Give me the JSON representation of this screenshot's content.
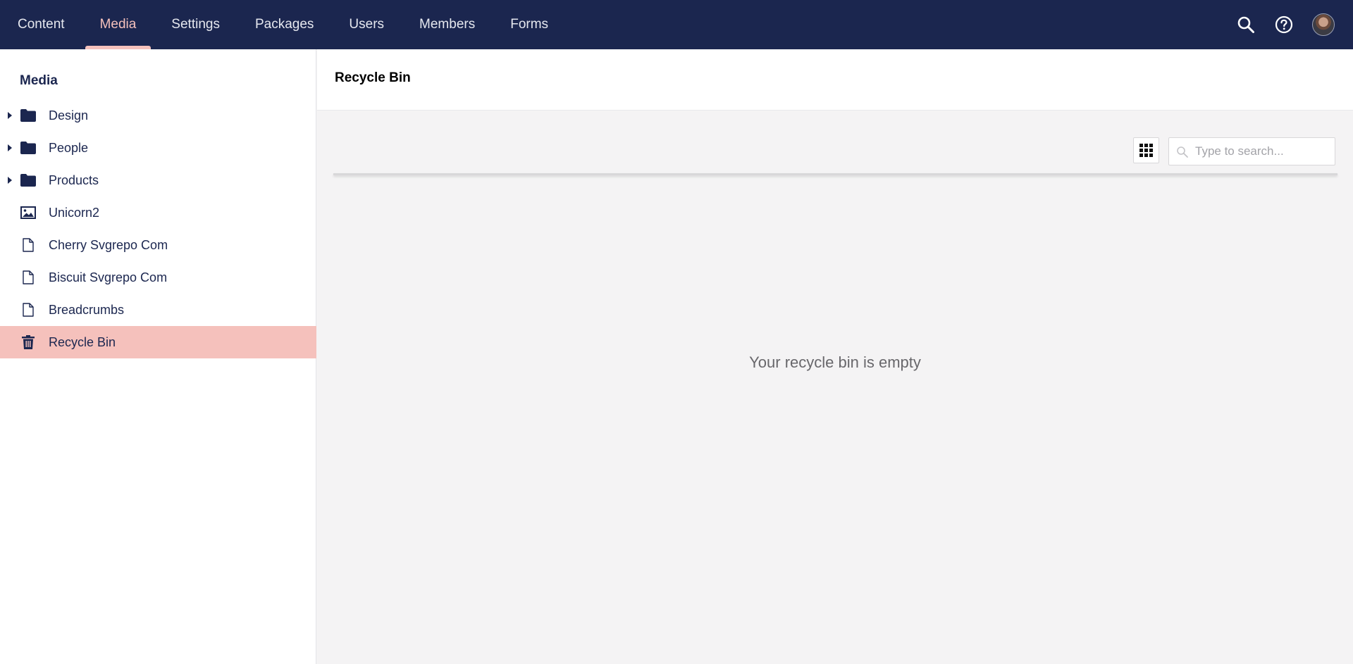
{
  "nav": {
    "items": [
      {
        "label": "Content"
      },
      {
        "label": "Media"
      },
      {
        "label": "Settings"
      },
      {
        "label": "Packages"
      },
      {
        "label": "Users"
      },
      {
        "label": "Members"
      },
      {
        "label": "Forms"
      }
    ],
    "active": "Media"
  },
  "sidebar": {
    "title": "Media",
    "items": [
      {
        "label": "Design",
        "icon": "folder-icon",
        "expandable": true
      },
      {
        "label": "People",
        "icon": "folder-icon",
        "expandable": true
      },
      {
        "label": "Products",
        "icon": "folder-icon",
        "expandable": true
      },
      {
        "label": "Unicorn2",
        "icon": "image-icon",
        "expandable": false
      },
      {
        "label": "Cherry Svgrepo Com",
        "icon": "file-icon",
        "expandable": false
      },
      {
        "label": "Biscuit Svgrepo Com",
        "icon": "file-icon",
        "expandable": false
      },
      {
        "label": "Breadcrumbs",
        "icon": "file-icon",
        "expandable": false
      },
      {
        "label": "Recycle Bin",
        "icon": "trash-icon",
        "expandable": false,
        "selected": true
      }
    ]
  },
  "main": {
    "title": "Recycle Bin",
    "search": {
      "placeholder": "Type to search...",
      "value": ""
    },
    "empty_message": "Your recycle bin is empty"
  },
  "colors": {
    "nav_bg": "#1b264f",
    "accent": "#f5c1bc",
    "content_bg": "#f4f3f4"
  }
}
